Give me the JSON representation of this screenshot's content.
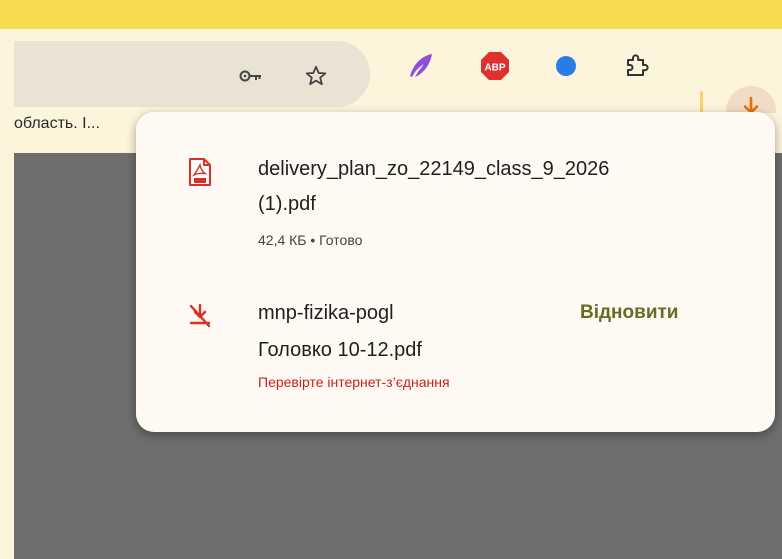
{
  "bookmarks": {
    "truncated_item": "область. І..."
  },
  "toolbar": {
    "key_icon": "key-icon",
    "star_icon": "star-icon",
    "extensions": [
      "feather-icon",
      "adblock-plus-icon",
      "blue-dot-icon",
      "puzzle-icon"
    ],
    "abp_text": "ABP",
    "download_icon": "download-icon"
  },
  "downloads": {
    "items": [
      {
        "name_line1": "delivery_plan_zo_22149_class_9_2026",
        "name_line2": "(1).pdf",
        "status": "42,4 КБ • Готово",
        "icon": "pdf-file-icon"
      },
      {
        "name_line1": "mnp-fizika-pogl",
        "name_line2": "Головко 10-12.pdf",
        "status": "Перевірте інтернет-з’єднання",
        "action": "Відновити",
        "icon": "download-failed-icon"
      }
    ]
  },
  "colors": {
    "accent": "#f7db4f",
    "error": "#c5221f",
    "action": "#6d6824",
    "download_active": "#e8710a"
  }
}
